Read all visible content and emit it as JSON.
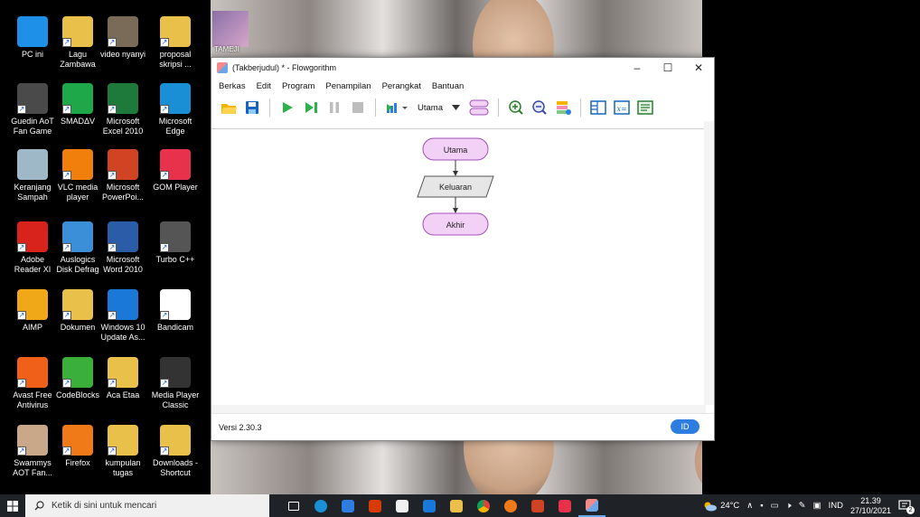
{
  "desktop": {
    "icons": [
      {
        "label": "PC ini",
        "icon": "pc-icon",
        "color": "#1e90e8"
      },
      {
        "label": "Lagu Zambawa",
        "icon": "folder-icon",
        "color": "#e8c04a"
      },
      {
        "label": "video nyanyi",
        "icon": "video-icon",
        "color": "#7a6a58"
      },
      {
        "label": "proposal skripsi ...",
        "icon": "folder-icon",
        "color": "#e8c04a"
      },
      {
        "label": "Guedin AoT Fan Game",
        "icon": "game-icon",
        "color": "#4a4a4a"
      },
      {
        "label": "SMADΔV",
        "icon": "smadav-icon",
        "color": "#1fa84a"
      },
      {
        "label": "Microsoft Excel 2010",
        "icon": "excel-icon",
        "color": "#1d7a3a"
      },
      {
        "label": "Microsoft Edge",
        "icon": "edge-icon",
        "color": "#1a8fd6"
      },
      {
        "label": "Keranjang Sampah",
        "icon": "recycle-bin-icon",
        "color": "#9fb8c8"
      },
      {
        "label": "VLC media player",
        "icon": "vlc-icon",
        "color": "#f07f0c"
      },
      {
        "label": "Microsoft PowerPoi...",
        "icon": "powerpoint-icon",
        "color": "#d04423"
      },
      {
        "label": "GOM Player",
        "icon": "gom-icon",
        "color": "#e8314a"
      },
      {
        "label": "Adobe Reader XI",
        "icon": "adobe-icon",
        "color": "#d8231c"
      },
      {
        "label": "Auslogics Disk Defrag",
        "icon": "defrag-icon",
        "color": "#3a8fd8"
      },
      {
        "label": "Microsoft Word 2010",
        "icon": "word-icon",
        "color": "#2b5ca8"
      },
      {
        "label": "Turbo C++",
        "icon": "turbo-icon",
        "color": "#555555"
      },
      {
        "label": "AIMP",
        "icon": "aimp-icon",
        "color": "#f0a818"
      },
      {
        "label": "Dokumen",
        "icon": "folder-icon",
        "color": "#e8c04a"
      },
      {
        "label": "Windows 10 Update As...",
        "icon": "windows-icon",
        "color": "#1a78d8"
      },
      {
        "label": "Bandicam",
        "icon": "bandicam-icon",
        "color": "#ffffff"
      },
      {
        "label": "Avast Free Antivirus",
        "icon": "avast-icon",
        "color": "#f06018"
      },
      {
        "label": "CodeBlocks",
        "icon": "codeblocks-icon",
        "color": "#3ab03a"
      },
      {
        "label": "Aca Etaa",
        "icon": "folder-icon",
        "color": "#e8c04a"
      },
      {
        "label": "Media Player Classic",
        "icon": "mpc-icon",
        "color": "#333333"
      },
      {
        "label": "Swammys AOT Fan...",
        "icon": "anime-icon",
        "color": "#c8a888"
      },
      {
        "label": "Firefox",
        "icon": "firefox-icon",
        "color": "#f07a18"
      },
      {
        "label": "kumpulan tugas",
        "icon": "folder-icon",
        "color": "#e8c04a"
      },
      {
        "label": "Downloads - Shortcut",
        "icon": "downloads-icon",
        "color": "#e8c04a"
      }
    ],
    "wallpaper_partial_label": "TAMEJI"
  },
  "window": {
    "title": "(Takberjudul) * - Flowgorithm",
    "controls": {
      "minimize": "–",
      "maximize": "☐",
      "close": "✕"
    },
    "menu": [
      "Berkas",
      "Edit",
      "Program",
      "Penampilan",
      "Perangkat",
      "Bantuan"
    ],
    "function_select": "Utama",
    "flowchart": {
      "start": "Utama",
      "output": "Keluaran",
      "end": "Akhir",
      "terminal_color": "#f3d1f7",
      "output_color": "#e6e6e6"
    },
    "status": {
      "version": "Versi 2.30.3",
      "language": "ID"
    }
  },
  "taskbar": {
    "search_placeholder": "Ketik di sini untuk mencari",
    "weather": "24°C",
    "lang": "IND",
    "time": "21.39",
    "date": "27/10/2021",
    "notif_count": "2"
  }
}
